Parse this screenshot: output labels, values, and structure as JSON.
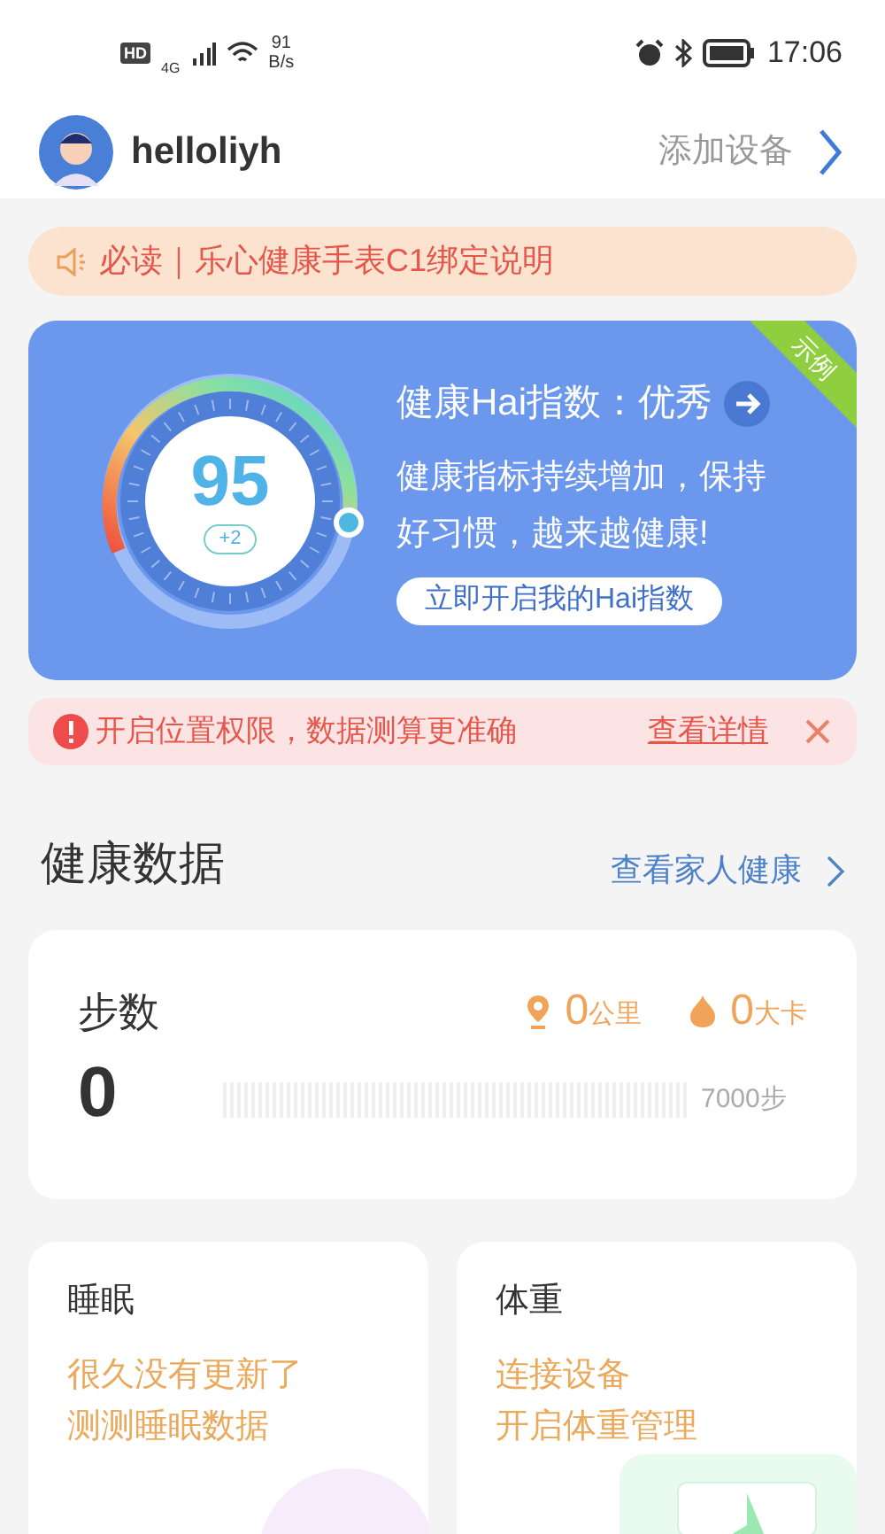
{
  "status_bar": {
    "hd": "HD",
    "network": "4G",
    "speed": "91",
    "speed_unit": "B/s",
    "time": "17:06"
  },
  "header": {
    "username": "helloliyh",
    "add_device": "添加设备"
  },
  "notice": {
    "text": "必读｜乐心健康手表C1绑定说明"
  },
  "hai_card": {
    "badge": "示例",
    "score": "95",
    "delta": "+2",
    "title": "健康Hai指数：优秀",
    "description": "健康指标持续增加，保持好习惯，越来越健康!",
    "button": "立即开启我的Hai指数"
  },
  "alert": {
    "text": "开启位置权限，数据测算更准确",
    "link": "查看详情"
  },
  "section": {
    "title": "健康数据",
    "link": "查看家人健康"
  },
  "steps": {
    "title": "步数",
    "distance": "0",
    "distance_unit": "公里",
    "calories": "0",
    "calories_unit": "大卡",
    "count": "0",
    "goal": "7000步",
    "level": 0
  },
  "tiles": [
    {
      "kind": "sleep",
      "title": "睡眠",
      "lines": [
        "很久没有更新了",
        "测测睡眠数据"
      ]
    },
    {
      "kind": "weight",
      "title": "体重",
      "lines": [
        "连接设备",
        "开启体重管理"
      ]
    }
  ]
}
